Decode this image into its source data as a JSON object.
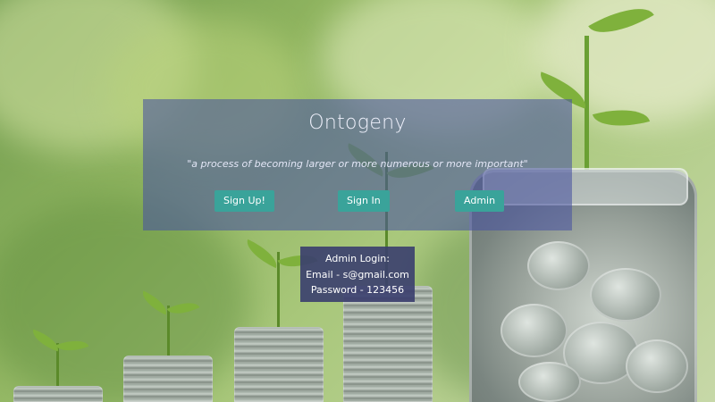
{
  "hero": {
    "title": "Ontogeny",
    "tagline": "\"a process of becoming larger or more numerous or more important\""
  },
  "buttons": {
    "signup_label": "Sign Up!",
    "signin_label": "Sign In",
    "admin_label": "Admin"
  },
  "admin_info": {
    "heading": "Admin Login:",
    "email_line": "Email - s@gmail.com",
    "password_line": "Password - 123456"
  },
  "colors": {
    "panel_overlay": "#4852a0",
    "button_bg": "#3aa39a",
    "admin_box_bg": "#3a3e6e"
  },
  "background_image": {
    "icon": "coins-plant-growth-photo"
  }
}
